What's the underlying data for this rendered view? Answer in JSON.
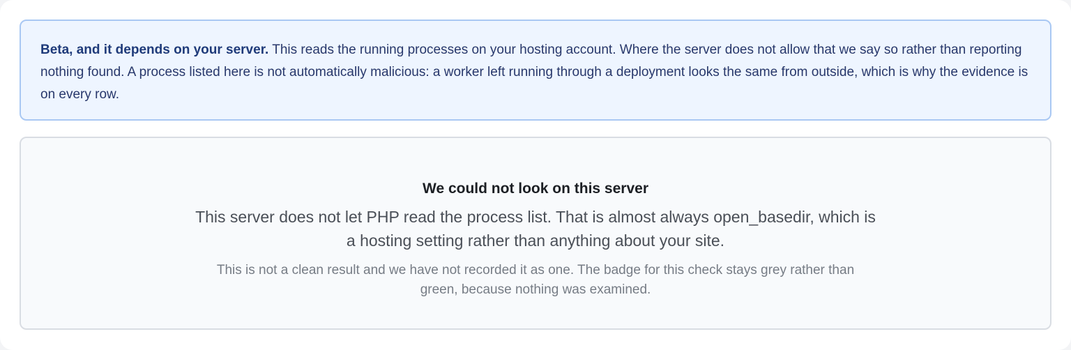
{
  "notice": {
    "lead": "Beta, and it depends on your server.",
    "text": " This reads the running processes on your hosting account. Where the server does not allow that we say so rather than reporting nothing found. A process listed here is not automatically malicious: a worker left running through a deployment looks the same from outside, which is why the evidence is on every row."
  },
  "status_panel": {
    "title": "We could not look on this server",
    "body": "This server does not let PHP read the process list. That is almost always open_basedir, which is a hosting setting rather than anything about your site.",
    "note": "This is not a clean result and we have not recorded it as one. The badge for this check stays grey rather than green, because nothing was examined."
  },
  "colors": {
    "notice_background": "#eef5ff",
    "notice_border": "#a9c8f3",
    "notice_text": "#28386b",
    "panel_background": "#f8fafc",
    "panel_border": "#d9dde3"
  }
}
